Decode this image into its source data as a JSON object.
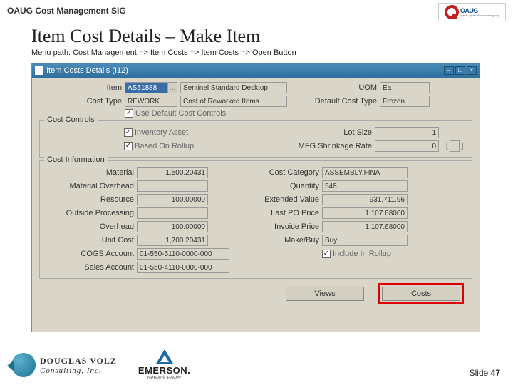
{
  "header": {
    "sig": "OAUG Cost Management SIG",
    "oaug": "OAUG",
    "oaug_sub": "oracle applications users group"
  },
  "title": "Item Cost Details – Make Item",
  "menu_path": "Menu path:  Cost Management => Item Costs  => Item Costs => Open Button",
  "window": {
    "title": "Item Costs Details (I12)",
    "top": {
      "item_lbl": "Item",
      "item_val": "AS51888",
      "item_desc": "Sentinel Standard Desktop",
      "uom_lbl": "UOM",
      "uom_val": "Ea",
      "costtype_lbl": "Cost Type",
      "costtype_val": "REWORK",
      "costtype_desc": "Cost of Reworked Items",
      "defcost_lbl": "Default Cost Type",
      "defcost_val": "Frozen",
      "usedef_lbl": "Use Default Cost Controls"
    },
    "controls": {
      "legend": "Cost Controls",
      "invasset_lbl": "Inventory Asset",
      "lotsize_lbl": "Lot Size",
      "lotsize_val": "1",
      "rollup_lbl": "Based On Rollup",
      "shrink_lbl": "MFG Shrinkage Rate",
      "shrink_val": "0",
      "bracket_l": "[",
      "bracket_r": "]"
    },
    "info": {
      "legend": "Cost Information",
      "material_lbl": "Material",
      "material_val": "1,500.20431",
      "costcat_lbl": "Cost Category",
      "costcat_val": "ASSEMBLY.FINA",
      "moh_lbl": "Material Overhead",
      "moh_val": "",
      "qty_lbl": "Quantity",
      "qty_val": "548",
      "resource_lbl": "Resource",
      "resource_val": "100.00000",
      "extval_lbl": "Extended Value",
      "extval_val": "931,711.96",
      "outside_lbl": "Outside Processing",
      "outside_val": "",
      "lastpo_lbl": "Last PO Price",
      "lastpo_val": "1,107.68000",
      "overhead_lbl": "Overhead",
      "overhead_val": "100.00000",
      "invoice_lbl": "Invoice Price",
      "invoice_val": "1,107.68000",
      "unitcost_lbl": "Unit Cost",
      "unitcost_val": "1,700.20431",
      "makebuy_lbl": "Make/Buy",
      "makebuy_val": "Buy",
      "cogs_lbl": "COGS Account",
      "cogs_val": "01-550-5110-0000-000",
      "include_lbl": "Include In Rollup",
      "sales_lbl": "Sales Account",
      "sales_val": "01-550-4110-0000-000"
    },
    "buttons": {
      "views": "Views",
      "costs": "Costs"
    }
  },
  "footer": {
    "dvc1": "DOUGLAS VOLZ",
    "dvc2": "Consulting, Inc.",
    "emerson": "EMERSON.",
    "emerson_sub": "Network Power",
    "slide_lbl": "Slide ",
    "slide_num": "47"
  }
}
